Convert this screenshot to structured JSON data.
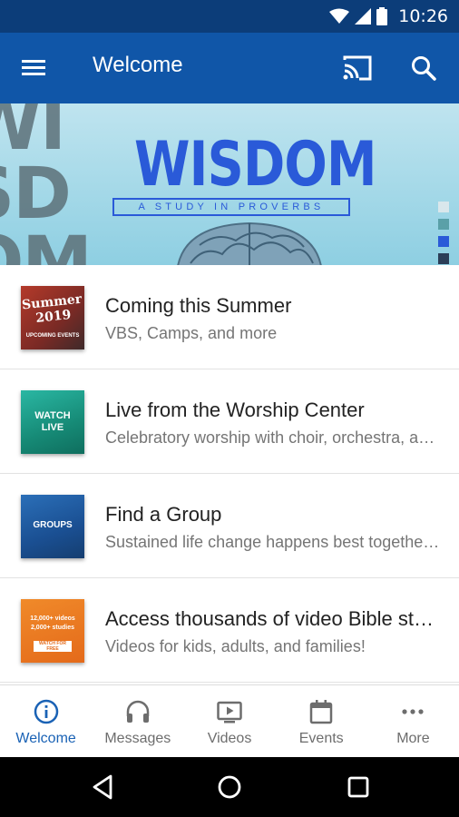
{
  "status_bar": {
    "time": "10:26"
  },
  "app_bar": {
    "title": "Welcome"
  },
  "banner": {
    "bg_text": "WI\nSD\nOM",
    "title": "WISDOM",
    "subtitle": "A STUDY IN PROVERBS",
    "dot_colors": [
      "#d9e7ec",
      "#5aa0a8",
      "#2a5ad8",
      "#2b3e58"
    ]
  },
  "list": {
    "items": [
      {
        "title": "Coming this Summer",
        "subtitle": "VBS, Camps, and more",
        "thumb_text": "Summer 2019",
        "thumb_small": "UPCOMING EVENTS"
      },
      {
        "title": "Live from the Worship Center",
        "subtitle": "Celebratory worship with choir, orchestra, and praise team",
        "thumb_text": "WATCH LIVE"
      },
      {
        "title": "Find a Group",
        "subtitle": "Sustained life change happens best together in small groups",
        "thumb_text": "GROUPS"
      },
      {
        "title": "Access thousands of video Bible studies",
        "subtitle": "Videos for kids, adults, and families!",
        "thumb_text": "12,000+ videos",
        "thumb_text2": "2,000+ studies",
        "thumb_small": "WATCH FOR FREE"
      }
    ]
  },
  "bottom_nav": {
    "items": [
      {
        "label": "Welcome",
        "icon": "info-icon",
        "active": true
      },
      {
        "label": "Messages",
        "icon": "headphones-icon",
        "active": false
      },
      {
        "label": "Videos",
        "icon": "video-icon",
        "active": false
      },
      {
        "label": "Events",
        "icon": "calendar-icon",
        "active": false
      },
      {
        "label": "More",
        "icon": "more-icon",
        "active": false
      }
    ]
  },
  "colors": {
    "status_bar": "#0c3d79",
    "app_bar": "#1056a8",
    "accent": "#1a62b5"
  }
}
